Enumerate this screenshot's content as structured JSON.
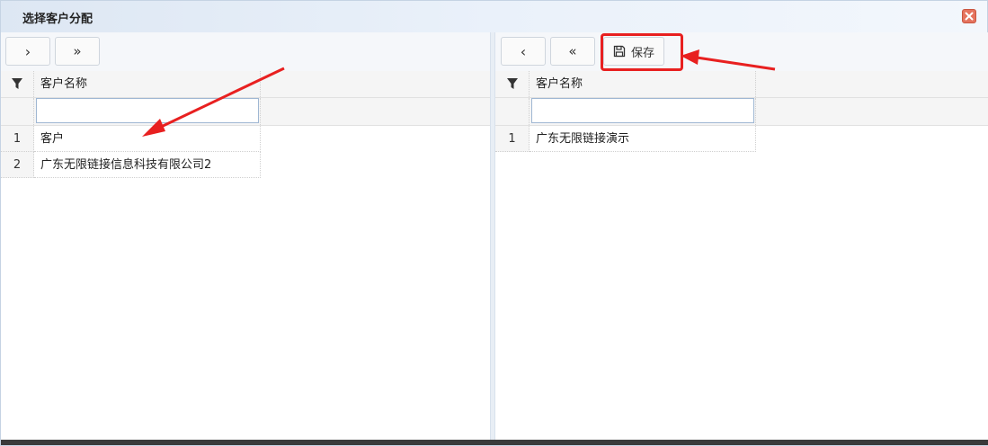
{
  "dialog": {
    "title": "选择客户分配"
  },
  "left": {
    "toolbar": {
      "add_one": "›",
      "add_all": "»"
    },
    "columns": [
      "客户名称"
    ],
    "filter_value": "",
    "rows": [
      {
        "num": "1",
        "name": "客户"
      },
      {
        "num": "2",
        "name": "广东无限链接信息科技有限公司2"
      }
    ]
  },
  "right": {
    "toolbar": {
      "remove_one": "‹",
      "remove_all": "«",
      "save_label": "保存"
    },
    "columns": [
      "客户名称"
    ],
    "filter_value": "",
    "rows": [
      {
        "num": "1",
        "name": "广东无限链接演示"
      }
    ]
  },
  "icons": {
    "filter": "filter-icon",
    "save": "floppy-disk-icon",
    "close": "close-icon"
  },
  "colors": {
    "annotation": "#e82020",
    "close_button": "#e5735e"
  }
}
